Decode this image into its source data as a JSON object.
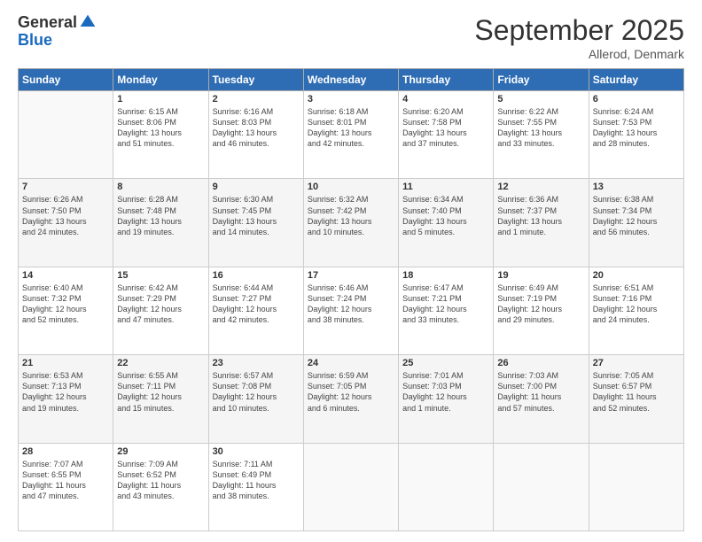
{
  "logo": {
    "general": "General",
    "blue": "Blue"
  },
  "title": "September 2025",
  "subtitle": "Allerod, Denmark",
  "days_header": [
    "Sunday",
    "Monday",
    "Tuesday",
    "Wednesday",
    "Thursday",
    "Friday",
    "Saturday"
  ],
  "weeks": [
    [
      {
        "day": "",
        "info": ""
      },
      {
        "day": "1",
        "info": "Sunrise: 6:15 AM\nSunset: 8:06 PM\nDaylight: 13 hours\nand 51 minutes."
      },
      {
        "day": "2",
        "info": "Sunrise: 6:16 AM\nSunset: 8:03 PM\nDaylight: 13 hours\nand 46 minutes."
      },
      {
        "day": "3",
        "info": "Sunrise: 6:18 AM\nSunset: 8:01 PM\nDaylight: 13 hours\nand 42 minutes."
      },
      {
        "day": "4",
        "info": "Sunrise: 6:20 AM\nSunset: 7:58 PM\nDaylight: 13 hours\nand 37 minutes."
      },
      {
        "day": "5",
        "info": "Sunrise: 6:22 AM\nSunset: 7:55 PM\nDaylight: 13 hours\nand 33 minutes."
      },
      {
        "day": "6",
        "info": "Sunrise: 6:24 AM\nSunset: 7:53 PM\nDaylight: 13 hours\nand 28 minutes."
      }
    ],
    [
      {
        "day": "7",
        "info": "Sunrise: 6:26 AM\nSunset: 7:50 PM\nDaylight: 13 hours\nand 24 minutes."
      },
      {
        "day": "8",
        "info": "Sunrise: 6:28 AM\nSunset: 7:48 PM\nDaylight: 13 hours\nand 19 minutes."
      },
      {
        "day": "9",
        "info": "Sunrise: 6:30 AM\nSunset: 7:45 PM\nDaylight: 13 hours\nand 14 minutes."
      },
      {
        "day": "10",
        "info": "Sunrise: 6:32 AM\nSunset: 7:42 PM\nDaylight: 13 hours\nand 10 minutes."
      },
      {
        "day": "11",
        "info": "Sunrise: 6:34 AM\nSunset: 7:40 PM\nDaylight: 13 hours\nand 5 minutes."
      },
      {
        "day": "12",
        "info": "Sunrise: 6:36 AM\nSunset: 7:37 PM\nDaylight: 13 hours\nand 1 minute."
      },
      {
        "day": "13",
        "info": "Sunrise: 6:38 AM\nSunset: 7:34 PM\nDaylight: 12 hours\nand 56 minutes."
      }
    ],
    [
      {
        "day": "14",
        "info": "Sunrise: 6:40 AM\nSunset: 7:32 PM\nDaylight: 12 hours\nand 52 minutes."
      },
      {
        "day": "15",
        "info": "Sunrise: 6:42 AM\nSunset: 7:29 PM\nDaylight: 12 hours\nand 47 minutes."
      },
      {
        "day": "16",
        "info": "Sunrise: 6:44 AM\nSunset: 7:27 PM\nDaylight: 12 hours\nand 42 minutes."
      },
      {
        "day": "17",
        "info": "Sunrise: 6:46 AM\nSunset: 7:24 PM\nDaylight: 12 hours\nand 38 minutes."
      },
      {
        "day": "18",
        "info": "Sunrise: 6:47 AM\nSunset: 7:21 PM\nDaylight: 12 hours\nand 33 minutes."
      },
      {
        "day": "19",
        "info": "Sunrise: 6:49 AM\nSunset: 7:19 PM\nDaylight: 12 hours\nand 29 minutes."
      },
      {
        "day": "20",
        "info": "Sunrise: 6:51 AM\nSunset: 7:16 PM\nDaylight: 12 hours\nand 24 minutes."
      }
    ],
    [
      {
        "day": "21",
        "info": "Sunrise: 6:53 AM\nSunset: 7:13 PM\nDaylight: 12 hours\nand 19 minutes."
      },
      {
        "day": "22",
        "info": "Sunrise: 6:55 AM\nSunset: 7:11 PM\nDaylight: 12 hours\nand 15 minutes."
      },
      {
        "day": "23",
        "info": "Sunrise: 6:57 AM\nSunset: 7:08 PM\nDaylight: 12 hours\nand 10 minutes."
      },
      {
        "day": "24",
        "info": "Sunrise: 6:59 AM\nSunset: 7:05 PM\nDaylight: 12 hours\nand 6 minutes."
      },
      {
        "day": "25",
        "info": "Sunrise: 7:01 AM\nSunset: 7:03 PM\nDaylight: 12 hours\nand 1 minute."
      },
      {
        "day": "26",
        "info": "Sunrise: 7:03 AM\nSunset: 7:00 PM\nDaylight: 11 hours\nand 57 minutes."
      },
      {
        "day": "27",
        "info": "Sunrise: 7:05 AM\nSunset: 6:57 PM\nDaylight: 11 hours\nand 52 minutes."
      }
    ],
    [
      {
        "day": "28",
        "info": "Sunrise: 7:07 AM\nSunset: 6:55 PM\nDaylight: 11 hours\nand 47 minutes."
      },
      {
        "day": "29",
        "info": "Sunrise: 7:09 AM\nSunset: 6:52 PM\nDaylight: 11 hours\nand 43 minutes."
      },
      {
        "day": "30",
        "info": "Sunrise: 7:11 AM\nSunset: 6:49 PM\nDaylight: 11 hours\nand 38 minutes."
      },
      {
        "day": "",
        "info": ""
      },
      {
        "day": "",
        "info": ""
      },
      {
        "day": "",
        "info": ""
      },
      {
        "day": "",
        "info": ""
      }
    ]
  ]
}
